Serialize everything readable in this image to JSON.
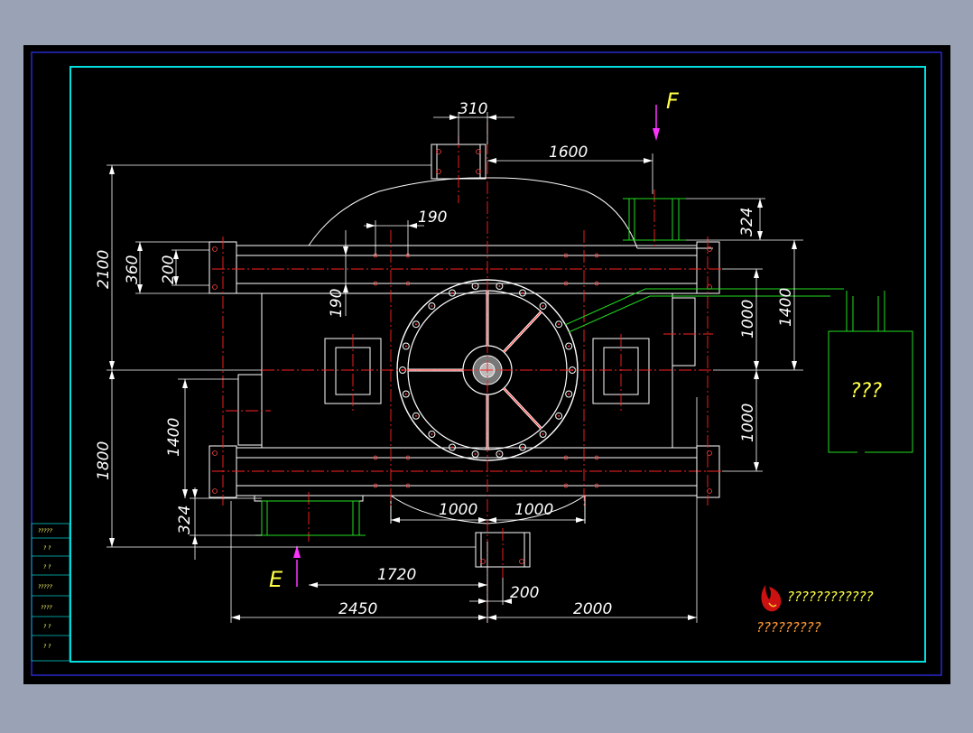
{
  "drawing": {
    "dims": {
      "d310": "310",
      "d1600": "1600",
      "d190a": "190",
      "d190b": "190",
      "d324top": "324",
      "d2100": "2100",
      "d360": "360",
      "d200": "200",
      "d1000a": "1000",
      "d1400right": "1400",
      "d1000b": "1000",
      "d1400left": "1400",
      "d1800": "1800",
      "d324bottom": "324",
      "d1000c": "1000",
      "d1000d": "1000",
      "d1720": "1720",
      "d200b": "200",
      "d2450": "2450",
      "d2000": "2000"
    },
    "view_labels": {
      "f": "F",
      "e": "E"
    },
    "box_label": "???",
    "title_block": {
      "company": "????????????",
      "subtitle": "?????????",
      "rows": [
        "?????",
        "? ?",
        "? ?",
        "?????",
        "????",
        "? ?",
        "? ?"
      ]
    }
  }
}
